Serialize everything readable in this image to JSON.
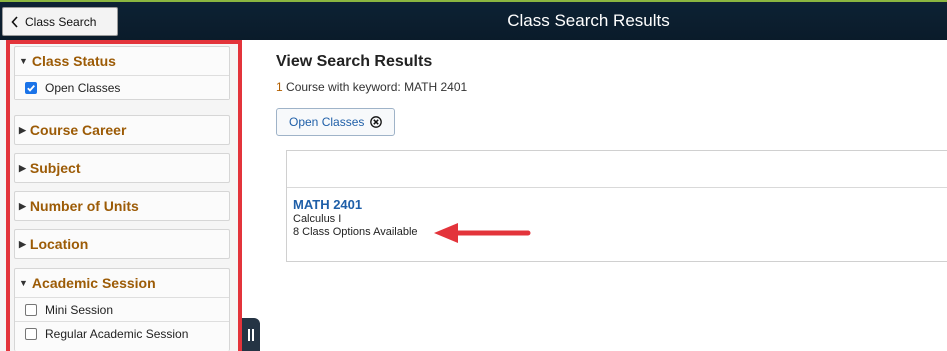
{
  "header": {
    "back_label": "Class Search",
    "title": "Class Search Results"
  },
  "filters": {
    "class_status": {
      "label": "Class Status",
      "options": [
        {
          "label": "Open Classes",
          "checked": true
        }
      ]
    },
    "course_career": {
      "label": "Course Career"
    },
    "subject": {
      "label": "Subject"
    },
    "number_of_units": {
      "label": "Number of Units"
    },
    "location": {
      "label": "Location"
    },
    "academic_session": {
      "label": "Academic Session",
      "options": [
        {
          "label": "Mini Session",
          "checked": false
        },
        {
          "label": "Regular Academic Session",
          "checked": false
        }
      ]
    }
  },
  "main": {
    "title": "View Search Results",
    "count": "1",
    "count_text": " Course with keyword: MATH 2401",
    "active_filter_chip": "Open Classes",
    "results": [
      {
        "code": "MATH 2401",
        "title": "Calculus I",
        "options": "8 Class Options Available"
      }
    ]
  },
  "colors": {
    "header_bg": "#0d2234",
    "facet_heading": "#9c5b06",
    "link": "#1f5fa8",
    "annotation_red": "#e3343b"
  }
}
